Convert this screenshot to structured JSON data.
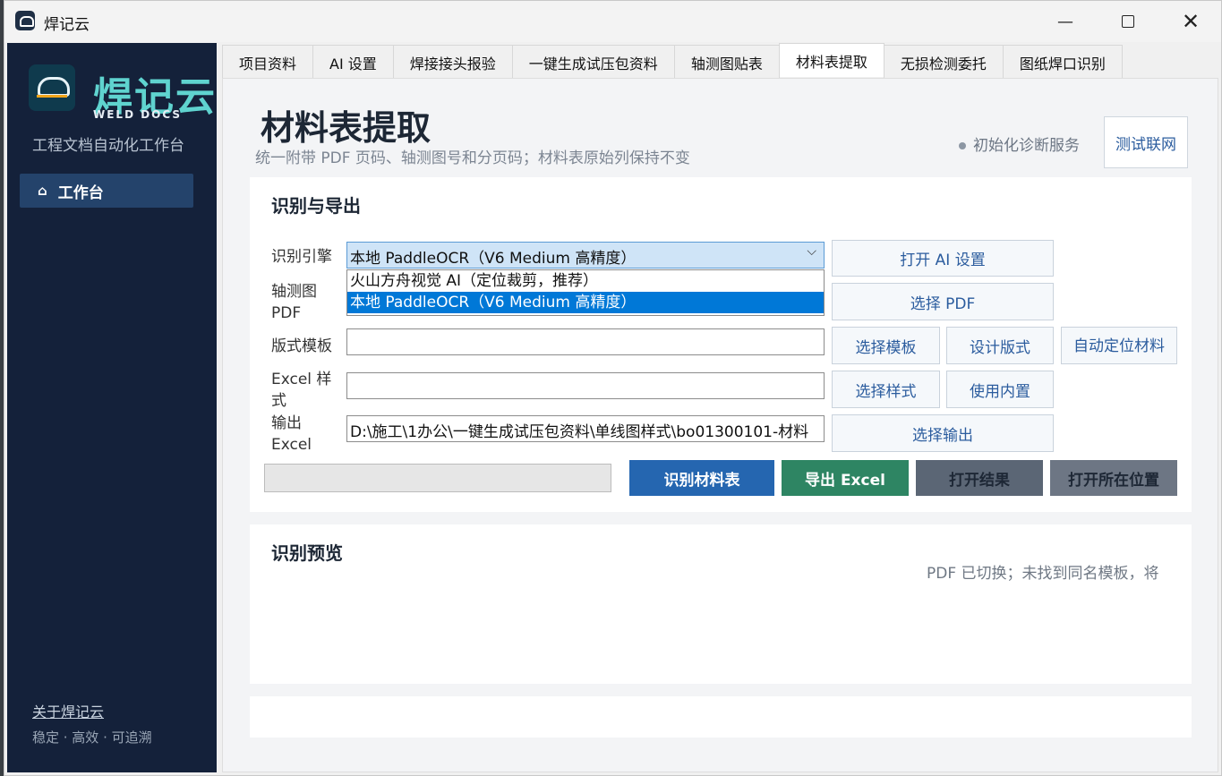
{
  "window": {
    "title": "焊记云"
  },
  "sidebar": {
    "logo_text": "焊记云",
    "logo_subtext": "WELD DOCS CL",
    "caption": "工程文档自动化工作台",
    "nav": [
      {
        "label": "工作台",
        "icon": "home-icon"
      }
    ],
    "about": "关于焊记云",
    "footer": "稳定 · 高效 · 可追溯"
  },
  "tabs": [
    "项目资料",
    "AI 设置",
    "焊接接头报验",
    "一键生成试压包资料",
    "轴测图贴表",
    "材料表提取",
    "无损检测委托",
    "图纸焊口识别"
  ],
  "active_tab": "材料表提取",
  "header": {
    "title": "材料表提取",
    "subtitle": "统一附带 PDF 页码、轴测图号和分页码；材料表原始列保持不变",
    "status": "初始化诊断服务",
    "test_button": "测试联网"
  },
  "recognize": {
    "title": "识别与导出",
    "engine_label": "识别引擎",
    "engine_value": "本地 PaddleOCR（V6 Medium 高精度）",
    "engine_options": [
      "火山方舟视觉 AI（定位裁剪，推荐）",
      "本地 PaddleOCR（V6 Medium 高精度）"
    ],
    "open_ai_settings": "打开 AI 设置",
    "pdf_label_1": "轴测图",
    "pdf_label_2": "PDF",
    "select_pdf": "选择 PDF",
    "template_label": "版式模板",
    "template_value": "",
    "select_template": "选择模板",
    "design_layout": "设计版式",
    "auto_locate": "自动定位材料",
    "style_label_1": "Excel 样",
    "style_label_2": "式",
    "style_value": "",
    "select_style": "选择样式",
    "use_builtin": "使用内置",
    "output_label_1": "输出",
    "output_label_2": "Excel",
    "output_value": "D:\\施工\\1办公\\一键生成试压包资料\\单线图样式\\bo01300101-材料",
    "select_output": "选择输出",
    "progress": 0,
    "btn_recognize": "识别材料表",
    "btn_export": "导出 Excel",
    "btn_open_result": "打开结果",
    "btn_open_location": "打开所在位置"
  },
  "preview": {
    "title": "识别预览",
    "hint": "PDF 已切换；未找到同名模板，将"
  },
  "colors": {
    "sidebar_bg": "#14213a",
    "accent_blue": "#2566b0",
    "export_green": "#2e8563",
    "gray_button": "#5b6675",
    "gray_button_2": "#6d7684",
    "logo_teal": "#5fd3cf"
  }
}
